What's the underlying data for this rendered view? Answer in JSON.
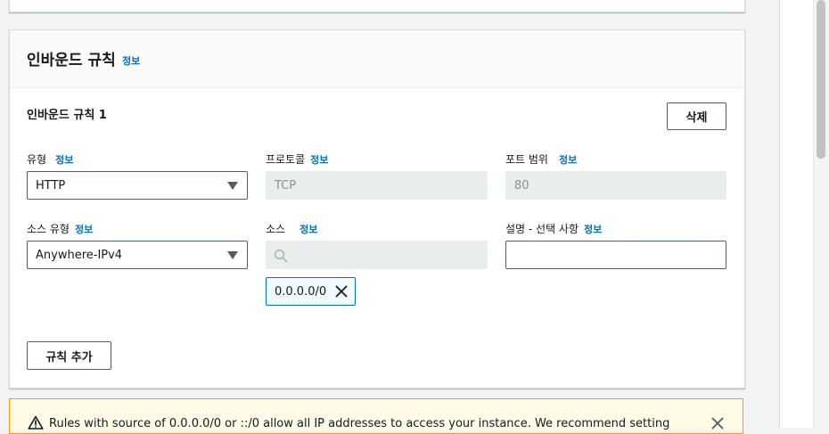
{
  "section": {
    "title": "인바운드 규칙",
    "info": "정보"
  },
  "rule": {
    "title": "인바운드 규칙 1",
    "delete_label": "삭제",
    "type": {
      "label": "유형",
      "info": "정보",
      "value": "HTTP"
    },
    "protocol": {
      "label": "프로토콜",
      "info": "정보",
      "value": "TCP"
    },
    "port_range": {
      "label": "포트 범위",
      "info": "정보",
      "value": "80"
    },
    "source_type": {
      "label": "소스 유형",
      "info": "정보",
      "value": "Anywhere-IPv4"
    },
    "source": {
      "label": "소스",
      "info": "정보",
      "search_value": "",
      "tokens": [
        "0.0.0.0/0"
      ]
    },
    "description": {
      "label": "설명 - 선택 사항",
      "info": "정보",
      "value": ""
    }
  },
  "add_rule_label": "규칙 추가",
  "alert": {
    "text": "Rules with source of 0.0.0.0/0 or ::/0 allow all IP addresses to access your instance. We recommend setting",
    "color": "#ff9900"
  },
  "colors": {
    "link": "#0073bb",
    "token_border": "#0073bb"
  }
}
